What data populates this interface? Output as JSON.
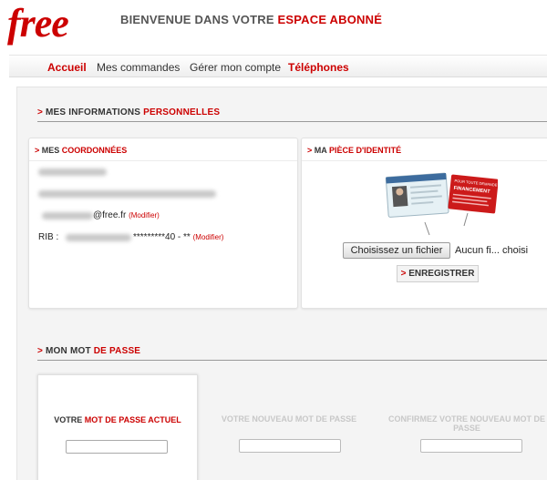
{
  "header": {
    "logo": "free",
    "welcome_prefix": "BIENVENUE DANS VOTRE ",
    "welcome_highlight": "ESPACE ABONNÉ"
  },
  "nav": {
    "items": [
      {
        "label": "Accueil"
      },
      {
        "label": "Mes commandes"
      },
      {
        "label": "Gérer mon compte"
      },
      {
        "label": "Téléphones"
      }
    ]
  },
  "info_section": {
    "arrow": ">",
    "title_prefix": "MES INFORMATIONS ",
    "title_highlight": "PERSONNELLES"
  },
  "coordonnees": {
    "arrow": ">",
    "title_prefix": "MES ",
    "title_highlight": "COORDONNÉES",
    "email_suffix": "@free.fr",
    "modify_label": "(Modifier)",
    "rib_label": "RIB :",
    "rib_masked": "*********40 - **"
  },
  "identite": {
    "arrow": ">",
    "title_prefix": "MA ",
    "title_highlight": "PIÈCE D'IDENTITÉ",
    "choose_file_label": "Choisissez un fichier",
    "no_file_label": "Aucun fi... choisi",
    "save_arrow": ">",
    "save_label": "ENREGISTRER",
    "tag_small_text": "POUR TOUTE DEMANDE DE",
    "tag_big_text": "FINANCEMENT"
  },
  "password_section": {
    "arrow": ">",
    "title_prefix": "MON MOT ",
    "title_highlight": "DE PASSE",
    "fields": [
      {
        "prefix": "VOTRE ",
        "highlight": "MOT DE PASSE ACTUEL",
        "value": ""
      },
      {
        "prefix": "VOTRE ",
        "highlight": "NOUVEAU MOT DE PASSE",
        "value": ""
      },
      {
        "prefix": "CONFIRMEZ VOTRE ",
        "highlight": "NOUVEAU MOT DE PASSE",
        "value": ""
      }
    ]
  },
  "colors": {
    "brand_red": "#cc0000",
    "text_dark": "#333333",
    "muted": "#c8c8c8"
  }
}
